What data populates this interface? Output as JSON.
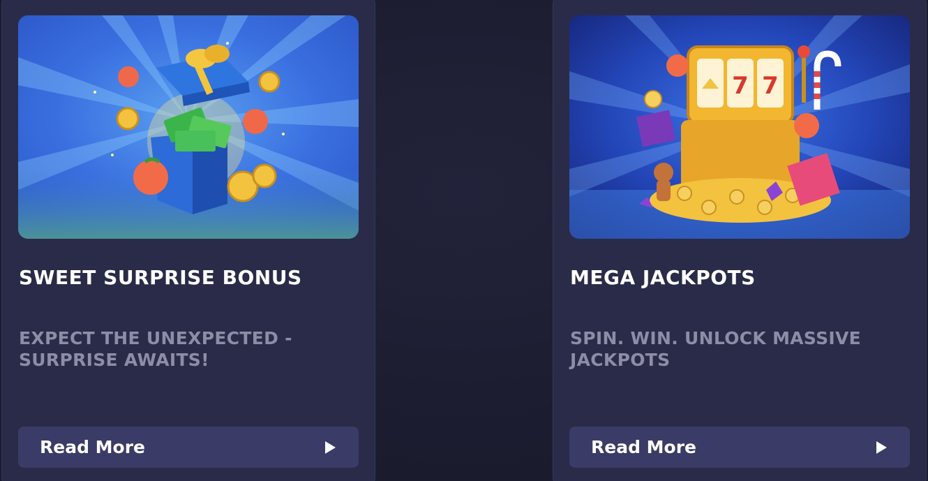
{
  "cards": [
    {
      "title": "SWEET SURPRISE BONUS",
      "subtitle": "EXPECT THE UNEXPECTED - SURPRISE AWAITS!",
      "button_label": "Read More",
      "button_icon": "play-triangle-icon",
      "image": "gift-box-with-cash-illustration"
    },
    {
      "title": "MEGA JACKPOTS",
      "subtitle": "SPIN. WIN. UNLOCK MASSIVE JACKPOTS",
      "button_label": "Read More",
      "button_icon": "play-triangle-icon",
      "image": "slot-machine-jackpot-illustration"
    }
  ],
  "colors": {
    "background": "#1c1c30",
    "card": "#2a2b48",
    "button": "#3a3b66",
    "title": "#ffffff",
    "subtitle": "#8d8da7"
  }
}
